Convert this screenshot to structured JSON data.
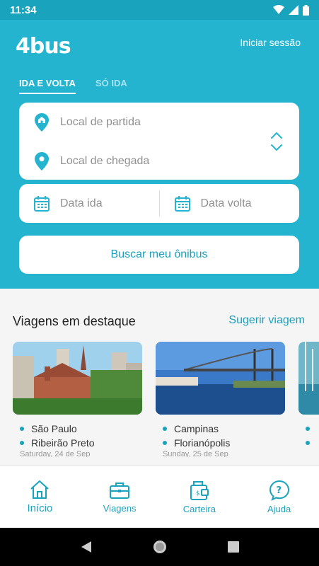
{
  "status_bar": {
    "time": "11:34"
  },
  "header": {
    "logo": "4bus",
    "login": "Iniciar sessão"
  },
  "tabs": [
    {
      "label": "IDA E VOLTA",
      "active": true
    },
    {
      "label": "SÓ IDA",
      "active": false
    }
  ],
  "form": {
    "origin_placeholder": "Local de partida",
    "destination_placeholder": "Local de chegada",
    "date_out_placeholder": "Data ida",
    "date_return_placeholder": "Data volta",
    "search_button": "Buscar meu ônibus"
  },
  "featured": {
    "title": "Viagens em destaque",
    "suggest": "Sugerir viagem",
    "trips": [
      {
        "from": "São Paulo",
        "to": "Ribeirão Preto",
        "date": "Saturday, 24 de Sep"
      },
      {
        "from": "Campinas",
        "to": "Florianópolis",
        "date": "Sunday, 25 de Sep"
      },
      {
        "from": "",
        "to": "",
        "date": ""
      }
    ]
  },
  "bottom_nav": [
    {
      "label": "Início",
      "icon": "home-icon",
      "active": true
    },
    {
      "label": "Viagens",
      "icon": "briefcase-icon",
      "active": false
    },
    {
      "label": "Carteira",
      "icon": "wallet-icon",
      "active": false
    },
    {
      "label": "Ajuda",
      "icon": "help-icon",
      "active": false
    }
  ],
  "colors": {
    "accent": "#25b4d0",
    "accent_dark": "#1aa3bd"
  }
}
